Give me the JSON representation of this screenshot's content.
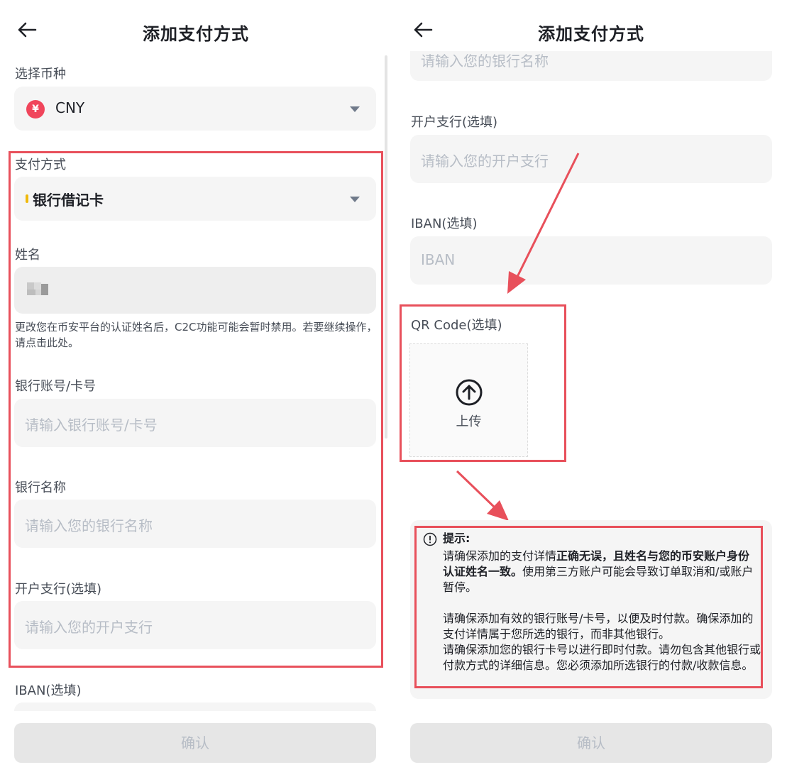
{
  "left": {
    "header": {
      "title": "添加支付方式",
      "back_icon": "arrow-left-icon"
    },
    "currency": {
      "label": "选择币种",
      "value": "CNY",
      "badge_symbol": "¥"
    },
    "payment_method": {
      "label": "支付方式",
      "value": "银行借记卡"
    },
    "name": {
      "label": "姓名",
      "note": "更改您在币安平台的认证姓名后，C2C功能可能会暂时禁用。若要继续操作，请点击此处。"
    },
    "bank_account": {
      "label": "银行账号/卡号",
      "placeholder": "请输入银行账号/卡号"
    },
    "bank_name": {
      "label": "银行名称",
      "placeholder": "请输入您的银行名称"
    },
    "branch": {
      "label": "开户支行(选填)",
      "placeholder": "请输入您的开户支行"
    },
    "iban": {
      "label": "IBAN(选填)"
    },
    "confirm_label": "确认"
  },
  "right": {
    "header": {
      "title": "添加支付方式",
      "back_icon": "arrow-left-icon"
    },
    "bank_name": {
      "placeholder": "请输入您的银行名称"
    },
    "branch": {
      "label": "开户支行(选填)",
      "placeholder": "请输入您的开户支行"
    },
    "iban": {
      "label": "IBAN(选填)",
      "placeholder": "IBAN"
    },
    "qr": {
      "label": "QR Code(选填)",
      "upload_label": "上传",
      "upload_icon": "upload-arrow-icon"
    },
    "tip": {
      "title": "提示:",
      "p1_a": "请确保添加的支付详情",
      "p1_bold": "正确无误，且姓名与您的币安账户身份认证姓名一致。",
      "p1_b": "使用第三方账户可能会导致订单取消和/或账户暂停。",
      "p2": "请确保添加有效的银行账号/卡号，以便及时付款。确保添加的支付详情属于您所选的银行，而非其他银行。",
      "p3": "请确保添加您的银行卡号以进行即时付款。请勿包含其他银行或付款方式的详细信息。您必须添加所选银行的付款/收款信息。",
      "icon": "info-circle-icon"
    },
    "confirm_label": "确认"
  },
  "colors": {
    "highlight": "#e8505b",
    "field_bg": "#f5f5f5",
    "badge": "#f0455b",
    "accent_yellow": "#f0b90b"
  }
}
